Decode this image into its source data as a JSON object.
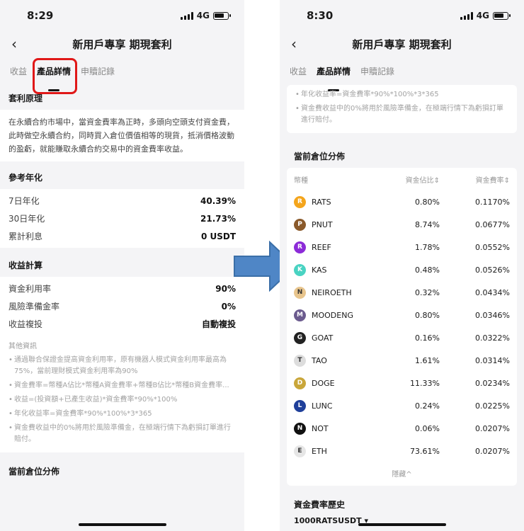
{
  "left": {
    "time": "8:29",
    "network": "4G",
    "title": "新用戶專享 期現套利",
    "tabs": [
      "收益",
      "產品詳情",
      "申贖記錄"
    ],
    "principle": {
      "title": "套利原理",
      "text": "在永續合約市場中，當資金費率為正時，多頭向空頭支付資金費，此時做空永續合約，同時買入倉位價值相等的現貨，抵消價格波動的盈虧，就能賺取永續合約交易中的資金費率收益。"
    },
    "annual": {
      "title": "參考年化",
      "rows": [
        {
          "k": "7日年化",
          "v": "40.39%"
        },
        {
          "k": "30日年化",
          "v": "21.73%"
        },
        {
          "k": "累計利息",
          "v": "0 USDT"
        }
      ]
    },
    "calc": {
      "title": "收益計算",
      "rows": [
        {
          "k": "資金利用率",
          "v": "90%"
        },
        {
          "k": "風險準備金率",
          "v": "0%"
        },
        {
          "k": "收益複投",
          "v": "自動複投"
        }
      ]
    },
    "other": {
      "title": "其他資訊",
      "notes": [
        "通過聯合保證金提高資金利用率，原有機器人模式資金利用率最高為75%，當前理財模式資金利用率為90%",
        "資金費率=幣種A佔比*幣種A資金費率+幣種B佔比*幣種B資金費率...",
        "收益=(投資額+已產生收益)*資金費率*90%*100%",
        "年化收益率=資金費率*90%*100%*3*365",
        "資金費收益中的0%將用於風險準備金，在極端行情下為虧損訂單進行賠付。"
      ]
    },
    "next_title": "當前倉位分佈"
  },
  "right": {
    "time": "8:30",
    "network": "4G",
    "title": "新用戶專享 期現套利",
    "tabs": [
      "收益",
      "產品詳情",
      "申贖記錄"
    ],
    "top_notes": [
      "年化收益率=資金費率*90%*100%*3*365",
      "資金費收益中的0%將用於風險準備金，在極端行情下為虧損訂單進行賠付。"
    ],
    "position": {
      "title": "當前倉位分佈",
      "headers": [
        "幣種",
        "資金佔比⇕",
        "資金費率⇕"
      ],
      "rows": [
        {
          "coin": "RATS",
          "share": "0.80%",
          "rate": "0.1170%",
          "color": "#f4a51c",
          "glyph": "R"
        },
        {
          "coin": "PNUT",
          "share": "8.74%",
          "rate": "0.0677%",
          "color": "#8a5a2b",
          "glyph": "P"
        },
        {
          "coin": "REEF",
          "share": "1.78%",
          "rate": "0.0552%",
          "color": "#8c2bd8",
          "glyph": "R"
        },
        {
          "coin": "KAS",
          "share": "0.48%",
          "rate": "0.0526%",
          "color": "#49d3c2",
          "glyph": "K"
        },
        {
          "coin": "NEIROETH",
          "share": "0.32%",
          "rate": "0.0434%",
          "color": "#e8c58d",
          "glyph": "N"
        },
        {
          "coin": "MOODENG",
          "share": "0.80%",
          "rate": "0.0346%",
          "color": "#6b5b8e",
          "glyph": "M"
        },
        {
          "coin": "GOAT",
          "share": "0.16%",
          "rate": "0.0322%",
          "color": "#222222",
          "glyph": "G"
        },
        {
          "coin": "TAO",
          "share": "1.61%",
          "rate": "0.0314%",
          "color": "#dddddd",
          "glyph": "T"
        },
        {
          "coin": "DOGE",
          "share": "11.33%",
          "rate": "0.0234%",
          "color": "#c9a63a",
          "glyph": "D"
        },
        {
          "coin": "LUNC",
          "share": "0.24%",
          "rate": "0.0225%",
          "color": "#1f3f9a",
          "glyph": "L"
        },
        {
          "coin": "NOT",
          "share": "0.06%",
          "rate": "0.0207%",
          "color": "#111111",
          "glyph": "N"
        },
        {
          "coin": "ETH",
          "share": "73.61%",
          "rate": "0.0207%",
          "color": "#e6e6e6",
          "glyph": "E"
        }
      ],
      "collapse": "隱藏^"
    },
    "history_title": "資金費率歷史",
    "history_symbol": "1000RATSUSDT ▾"
  }
}
